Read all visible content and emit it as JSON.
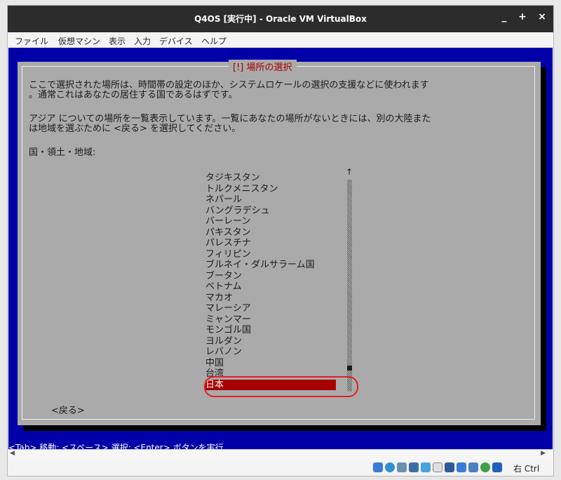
{
  "window": {
    "title": "Q4OS [実行中] - Oracle VM VirtualBox",
    "controls": [
      "_",
      "+",
      "×"
    ]
  },
  "menu": [
    "ファイル",
    "仮想マシン",
    "表示",
    "入力",
    "デバイス",
    "ヘルプ"
  ],
  "dialog": {
    "title": "[!] 場所の選択",
    "para1_line1": "ここで選択された場所は、時間帯の設定のほか、システムロケールの選択の支援などに使われます",
    "para1_line2": "。通常これはあなたの居住する国であるはずです。",
    "para2_line1": "アジア についての場所を一覧表示しています。一覧にあなたの場所がないときには、別の大陸また",
    "para2_line2": "は地域を選ぶために <戻る> を選択してください。",
    "list_label": "国・領土・地域:",
    "items": [
      "タジキスタン",
      "トルクメニスタン",
      "ネパール",
      "バングラデシュ",
      "バーレーン",
      "パキスタン",
      "パレスチナ",
      "フィリピン",
      "ブルネイ・ダルサラーム国",
      "ブータン",
      "ベトナム",
      "マカオ",
      "マレーシア",
      "ミャンマー",
      "モンゴル国",
      "ヨルダン",
      "レバノン",
      "中国",
      "台湾",
      "日本"
    ],
    "selected": "日本",
    "back_button": "<戻る>"
  },
  "status_line": "<Tab> 移動; <スペース> 選択; <Enter> ボタンを実行",
  "host_key": "右 Ctrl",
  "colors": {
    "vm_bg": "#0000a8",
    "dialog_bg": "#aaaaaa",
    "selection": "#a80000",
    "highlight": "#e02020"
  }
}
